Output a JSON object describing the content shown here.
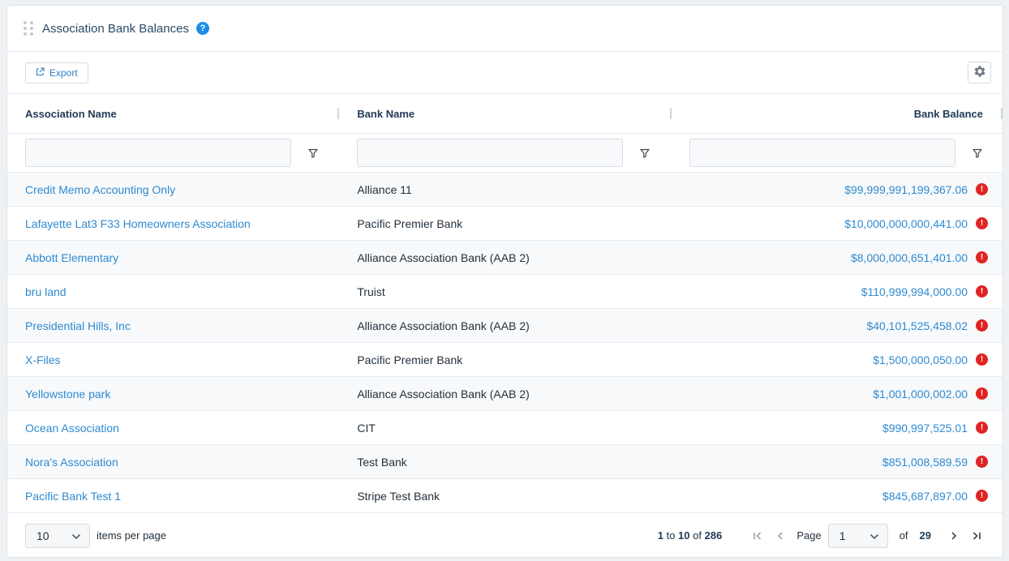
{
  "header": {
    "title": "Association Bank Balances",
    "help": "?"
  },
  "toolbar": {
    "export_label": "Export"
  },
  "columns": [
    "Association Name",
    "Bank Name",
    "Bank Balance"
  ],
  "rows": [
    {
      "association": "Credit Memo Accounting Only",
      "bank": "Alliance 11",
      "balance": "$99,999,991,199,367.06"
    },
    {
      "association": "Lafayette Lat3 F33 Homeowners Association",
      "bank": "Pacific Premier Bank",
      "balance": "$10,000,000,000,441.00"
    },
    {
      "association": "Abbott Elementary",
      "bank": "Alliance Association Bank (AAB 2)",
      "balance": "$8,000,000,651,401.00"
    },
    {
      "association": "bru land",
      "bank": "Truist",
      "balance": "$110,999,994,000.00"
    },
    {
      "association": "Presidential Hills, Inc",
      "bank": "Alliance Association Bank (AAB 2)",
      "balance": "$40,101,525,458.02"
    },
    {
      "association": "X-Files",
      "bank": "Pacific Premier Bank",
      "balance": "$1,500,000,050.00"
    },
    {
      "association": "Yellowstone park",
      "bank": "Alliance Association Bank (AAB 2)",
      "balance": "$1,001,000,002.00"
    },
    {
      "association": "Ocean Association",
      "bank": "CIT",
      "balance": "$990,997,525.01"
    },
    {
      "association": "Nora's Association",
      "bank": "Test Bank",
      "balance": "$851,008,589.59"
    },
    {
      "association": "Pacific Bank Test 1",
      "bank": "Stripe Test Bank",
      "balance": "$845,687,897.00"
    }
  ],
  "footer": {
    "page_size": "10",
    "items_per_page_label": "items per page",
    "range_start": "1",
    "range_to": "to",
    "range_end": "10",
    "range_of": "of",
    "total_items": "286",
    "page_label": "Page",
    "current_page": "1",
    "of_label": "of",
    "total_pages": "29"
  },
  "icons": {
    "alert": "!",
    "chevron": "chevron-down-icon"
  },
  "colors": {
    "link": "#2f8ad0",
    "alert": "#e02424",
    "help": "#1e8fe8"
  }
}
